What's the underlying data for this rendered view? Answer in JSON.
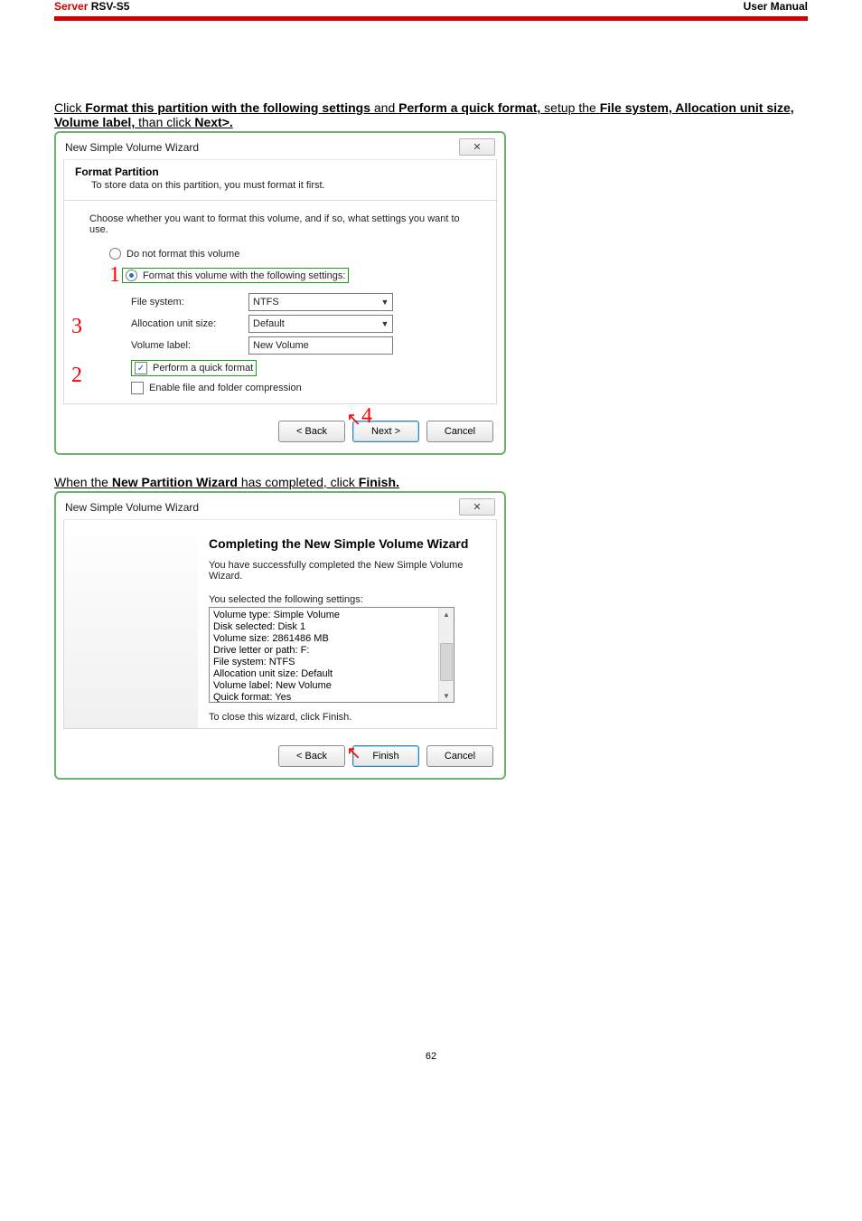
{
  "header": {
    "server": "Server",
    "model": " RSV-S5",
    "right": "User Manual"
  },
  "instr1": {
    "pre": "Click ",
    "b1": "Format this partition with the following settings",
    "mid1": " and ",
    "b2": "Perform a quick format,",
    "mid2": " setup the ",
    "b3": "File system, Allocation unit size, Volume label,",
    "mid3": " than click ",
    "b4": "Next>."
  },
  "dlg1": {
    "title": "New Simple Volume Wizard",
    "format_partition": "Format Partition",
    "format_partition_sub": "To store data on this partition, you must format it first.",
    "choose": "Choose whether you want to format this volume, and if so, what settings you want to use.",
    "opt_noformat": "Do not format this volume",
    "opt_format": "Format this volume with the following settings:",
    "lab_fs": "File system:",
    "val_fs": "NTFS",
    "lab_au": "Allocation unit size:",
    "val_au": "Default",
    "lab_vl": "Volume label:",
    "val_vl": "New Volume",
    "chk_quick": "Perform a quick format",
    "chk_compress": "Enable file and folder compression",
    "btn_back": "< Back",
    "btn_next": "Next >",
    "btn_cancel": "Cancel",
    "n1": "1",
    "n2": "2",
    "n3": "3",
    "n4": "4"
  },
  "instr2": {
    "pre": "When the ",
    "b1": "New Partition Wizard",
    "mid": " has completed, click ",
    "b2": "Finish."
  },
  "dlg2": {
    "title": "New Simple Volume Wizard",
    "heading": "Completing the New Simple Volume Wizard",
    "msg": "You have successfully completed the New Simple Volume Wizard.",
    "selected": "You selected the following settings:",
    "items": [
      "Volume type: Simple Volume",
      "Disk selected: Disk 1",
      "Volume size: 2861486 MB",
      "Drive letter or path: F:",
      "File system: NTFS",
      "Allocation unit size: Default",
      "Volume label: New Volume",
      "Quick format: Yes"
    ],
    "close_hint": "To close this wizard, click Finish.",
    "btn_back": "< Back",
    "btn_finish": "Finish",
    "btn_cancel": "Cancel"
  },
  "page_num": "62"
}
